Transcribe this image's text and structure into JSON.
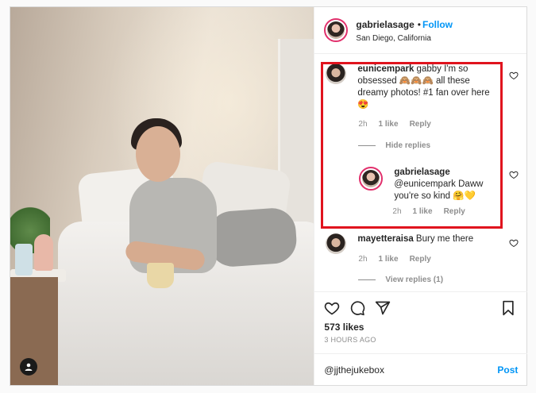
{
  "header": {
    "username": "gabrielasage",
    "dot": "•",
    "follow_label": "Follow",
    "location": "San Diego, California"
  },
  "comments": [
    {
      "username": "eunicempark",
      "text": " gabby I'm so obsessed 🙈🙈🙈 all these dreamy photos! #1 fan over here 😍",
      "time": "2h",
      "likes": "1 like",
      "reply_label": "Reply",
      "replies_toggle": "Hide replies"
    },
    {
      "username": "gabrielasage",
      "text": " @eunicempark Daww you're so kind 🤗💛",
      "time": "2h",
      "likes": "1 like",
      "reply_label": "Reply"
    },
    {
      "username": "mayetteraisa",
      "text": " Bury me there",
      "time": "2h",
      "likes": "1 like",
      "reply_label": "Reply",
      "replies_toggle": "View replies (1)"
    }
  ],
  "post": {
    "likes": "573 likes",
    "time_ago": "3 HOURS AGO"
  },
  "comment_box": {
    "value": "@jjthejukebox",
    "post_label": "Post"
  },
  "icons": [
    "heart-icon",
    "comment-icon",
    "share-icon",
    "bookmark-icon",
    "user-tag-icon"
  ],
  "colors": {
    "accent": "#0095f6",
    "highlight": "#e0141e",
    "muted": "#8e8e8e"
  }
}
